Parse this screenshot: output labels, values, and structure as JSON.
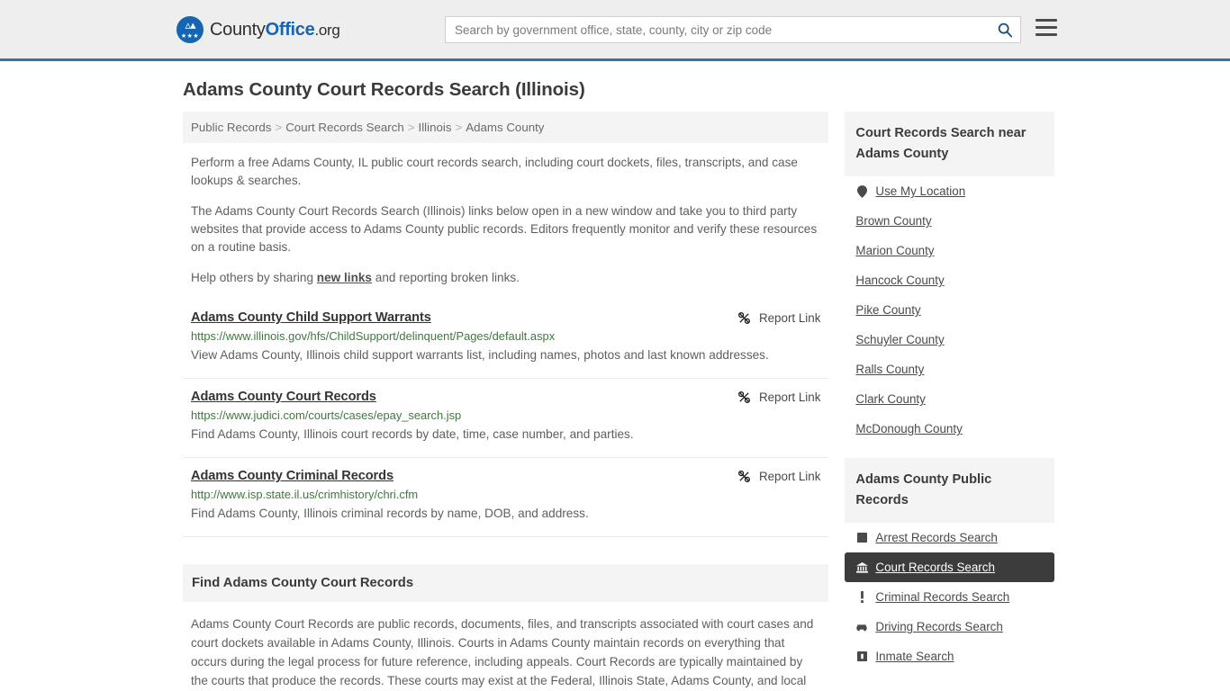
{
  "header": {
    "logo": {
      "part1": "County",
      "part2": "Office",
      "part3": ".org",
      "icon": "eagle-shield-logo"
    },
    "search": {
      "placeholder": "Search by government office, state, county, city or zip code",
      "value": "",
      "button_icon": "search-icon"
    },
    "menu_icon": "hamburger-menu-icon",
    "accent_color": "#3b72a4"
  },
  "page": {
    "title": "Adams County Court Records Search (Illinois)"
  },
  "breadcrumb": {
    "items": [
      "Public Records",
      "Court Records Search",
      "Illinois",
      "Adams County"
    ],
    "separator": ">"
  },
  "intro": {
    "p1": "Perform a free Adams County, IL public court records search, including court dockets, files, transcripts, and case lookups & searches.",
    "p2": "The Adams County Court Records Search (Illinois) links below open in a new window and take you to third party websites that provide access to Adams County public records. Editors frequently monitor and verify these resources on a routine basis.",
    "p3_before": "Help others by sharing ",
    "p3_link": "new links",
    "p3_after": " and reporting broken links."
  },
  "results": {
    "report_label": "Report Link",
    "report_icon": "broken-link-icon",
    "items": [
      {
        "title": "Adams County Child Support Warrants",
        "url": "https://www.illinois.gov/hfs/ChildSupport/delinquent/Pages/default.aspx",
        "description": "View Adams County, Illinois child support warrants list, including names, photos and last known addresses."
      },
      {
        "title": "Adams County Court Records",
        "url": "https://www.judici.com/courts/cases/epay_search.jsp",
        "description": "Find Adams County, Illinois court records by date, time, case number, and parties."
      },
      {
        "title": "Adams County Criminal Records",
        "url": "http://www.isp.state.il.us/crimhistory/chri.cfm",
        "description": "Find Adams County, Illinois criminal records by name, DOB, and address."
      }
    ]
  },
  "find_section": {
    "heading": "Find Adams County Court Records",
    "body": "Adams County Court Records are public records, documents, files, and transcripts associated with court cases and court dockets available in Adams County, Illinois. Courts in Adams County maintain records on everything that occurs during the legal process for future reference, including appeals. Court Records are typically maintained by the courts that produce the records. These courts may exist at the Federal, Illinois State, Adams County, and local"
  },
  "sidebar": {
    "near_box": {
      "heading": "Court Records Search near Adams County",
      "use_my_location": {
        "label": "Use My Location",
        "icon": "map-pin-icon"
      },
      "counties": [
        "Brown County",
        "Marion County",
        "Hancock County",
        "Pike County",
        "Schuyler County",
        "Ralls County",
        "Clark County",
        "McDonough County"
      ]
    },
    "public_records_box": {
      "heading": "Adams County Public Records",
      "items": [
        {
          "label": "Arrest Records Search",
          "icon": "fingerprint-square-icon",
          "active": false
        },
        {
          "label": "Court Records Search",
          "icon": "courthouse-icon",
          "active": true
        },
        {
          "label": "Criminal Records Search",
          "icon": "exclamation-icon",
          "active": false
        },
        {
          "label": "Driving Records Search",
          "icon": "car-icon",
          "active": false
        },
        {
          "label": "Inmate Search",
          "icon": "jail-building-icon",
          "active": false
        }
      ],
      "active_bg": "#3c3c3c"
    }
  }
}
